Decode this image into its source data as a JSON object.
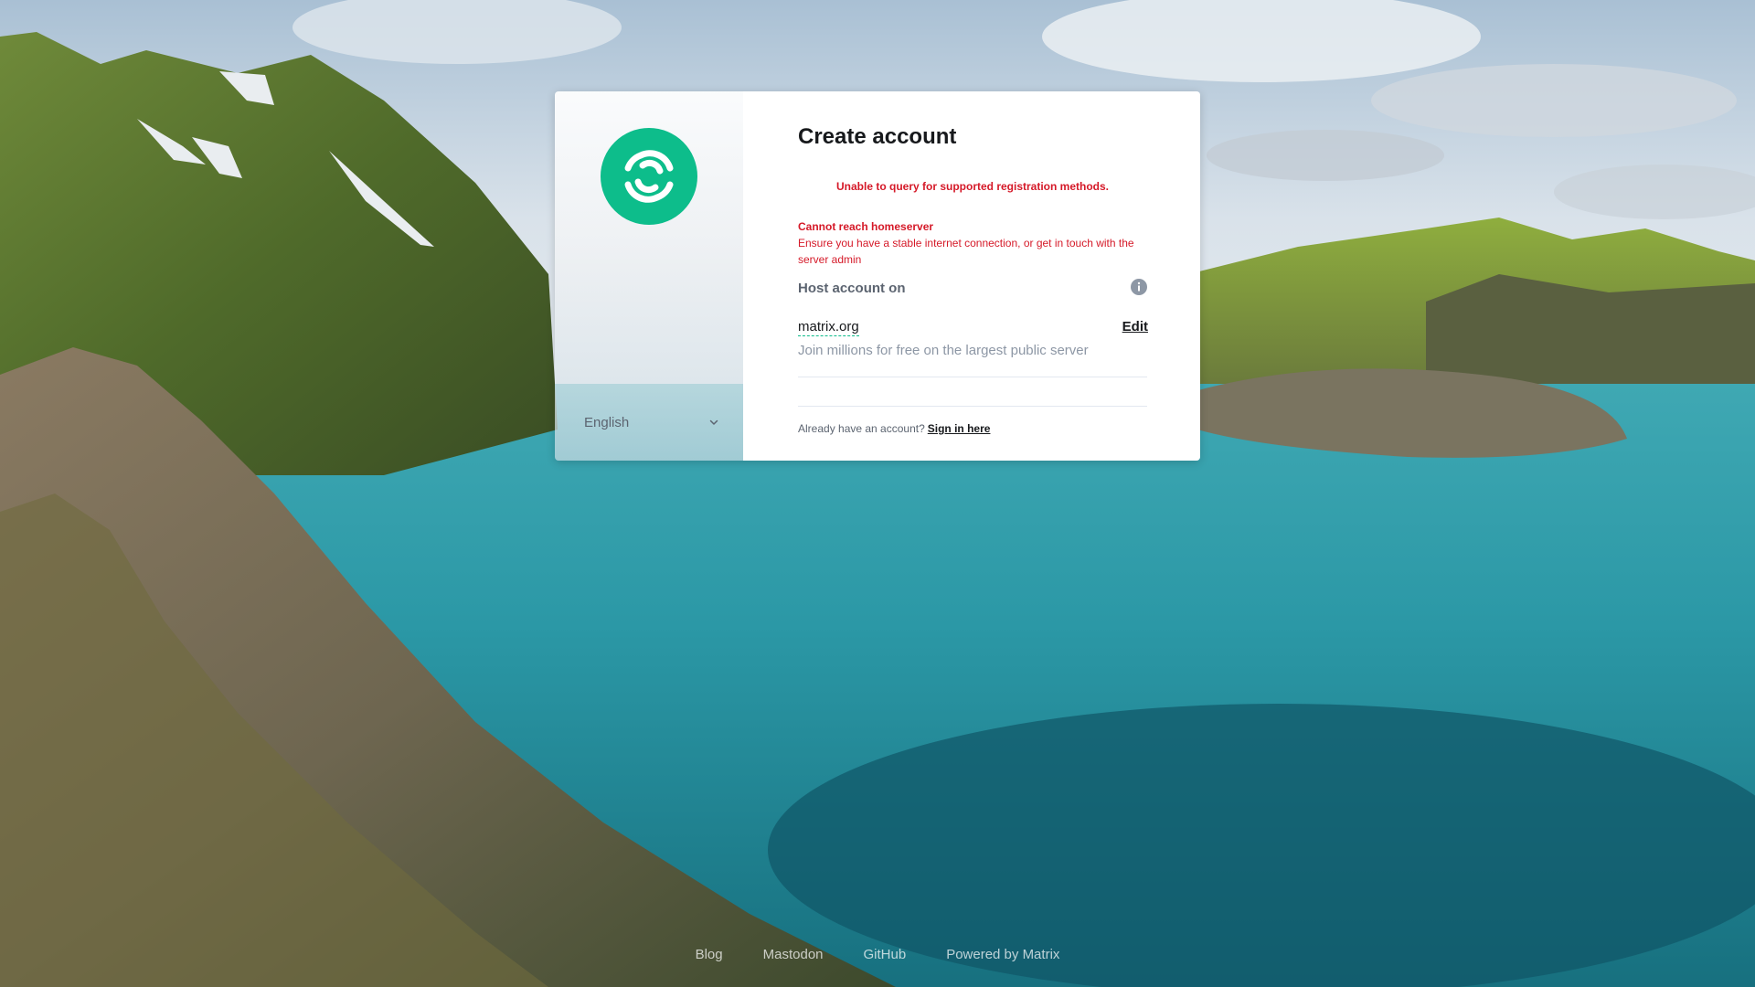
{
  "language": {
    "selected": "English"
  },
  "auth": {
    "title": "Create account",
    "error_registration": "Unable to query for supported registration methods.",
    "error_title": "Cannot reach homeserver",
    "error_detail": "Ensure you have a stable internet connection, or get in touch with the server admin",
    "host_label": "Host account on",
    "server_name": "matrix.org",
    "edit_label": "Edit",
    "server_description": "Join millions for free on the largest public server",
    "signin_prompt": "Already have an account?",
    "signin_link": "Sign in here"
  },
  "footer": {
    "links": [
      "Blog",
      "Mastodon",
      "GitHub"
    ],
    "powered": "Powered by Matrix"
  },
  "colors": {
    "brand": "#0dbd8b",
    "error": "#d51928",
    "text_primary": "#17191c",
    "text_secondary": "#5c6470",
    "text_muted": "#8d97a5"
  }
}
